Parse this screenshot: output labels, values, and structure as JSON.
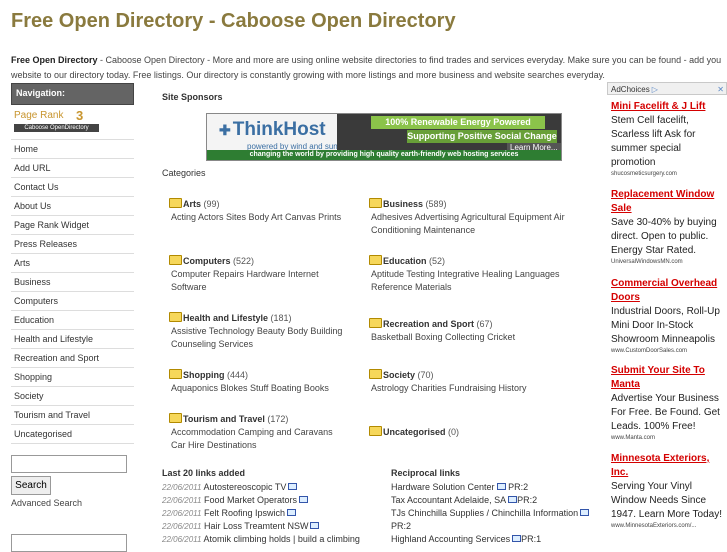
{
  "header": {
    "title": "Free Open Directory - Caboose Open Directory",
    "intro_bold": "Free Open Directory",
    "intro_rest": " - Caboose Open Directory - More and more are using online website directories to find trades and services everyday. Make sure you can be found - add you website to our directory today. Free listings. Our directory is constantly growing with more listings and more business and website searches everyday."
  },
  "sidebar": {
    "nav_title": "Navigation:",
    "page_rank_label": "Page Rank",
    "page_rank_value": "3",
    "page_rank_bar_text": "Caboose OpenDirectory",
    "items": [
      {
        "label": "Home"
      },
      {
        "label": "Add URL"
      },
      {
        "label": "Contact Us"
      },
      {
        "label": "About Us"
      },
      {
        "label": "Page Rank Widget"
      },
      {
        "label": "Press Releases"
      },
      {
        "label": "Arts"
      },
      {
        "label": "Business"
      },
      {
        "label": "Computers"
      },
      {
        "label": "Education"
      },
      {
        "label": "Health and Lifestyle"
      },
      {
        "label": "Recreation and Sport"
      },
      {
        "label": "Shopping"
      },
      {
        "label": "Society"
      },
      {
        "label": "Tourism and Travel"
      },
      {
        "label": "Uncategorised"
      }
    ],
    "search_button": "Search",
    "advanced_search": "Advanced Search"
  },
  "main": {
    "sponsors_title": "Site Sponsors",
    "banner": {
      "logo": "ThinkHost",
      "tagline": "powered by wind and sun",
      "slogan1": "100% Renewable Energy Powered",
      "slogan2": "Supporting Positive Social Change",
      "learn_more": "Learn More...",
      "strip": "changing the world by providing high quality earth-friendly web hosting services"
    },
    "categories_title": "Categories",
    "categories": [
      {
        "name": "Arts",
        "count": " (99)",
        "subs": "Acting Actors Sites Body Art Canvas Prints"
      },
      {
        "name": "Business",
        "count": " (589)",
        "subs": "Adhesives Advertising Agricultural Equipment Air Conditioning Maintenance"
      },
      {
        "name": "Computers",
        "count": " (522)",
        "subs": "Computer Repairs Hardware Internet Software"
      },
      {
        "name": "Education",
        "count": " (52)",
        "subs": "Aptitude Testing Integrative Healing Languages Reference Materials"
      },
      {
        "name": "Health and Lifestyle",
        "count": " (181)",
        "subs": "Assistive Technology Beauty Body Building Counseling Services"
      },
      {
        "name": "Recreation and Sport",
        "count": " (67)",
        "subs": "Basketball Boxing Collecting Cricket"
      },
      {
        "name": "Shopping",
        "count": " (444)",
        "subs": "Aquaponics Blokes Stuff Boating Books"
      },
      {
        "name": "Society",
        "count": " (70)",
        "subs": "Astrology Charities Fundraising History"
      },
      {
        "name": "Tourism and Travel",
        "count": " (172)",
        "subs": "Accommodation Camping and Caravans Car Hire Destinations"
      },
      {
        "name": "Uncategorised",
        "count": " (0)",
        "subs": ""
      }
    ],
    "last_links_title": "Last 20 links added",
    "last_links": [
      {
        "date": "22/06/2011",
        "text": " Autostereoscopic TV"
      },
      {
        "date": "22/06/2011",
        "text": " Food Market Operators"
      },
      {
        "date": "22/06/2011",
        "text": " Felt Roofing Ipswich"
      },
      {
        "date": "22/06/2011",
        "text": " Hair Loss Treamtent NSW"
      },
      {
        "date": "22/06/2011",
        "text": " Atomik climbing holds | build a climbing"
      }
    ],
    "reciprocal_title": "Reciprocal links",
    "reciprocal_links": [
      {
        "text": "Hardware Solution Center",
        "pr": "PR:2"
      },
      {
        "text": "Tax Accountant Adelaide, SA",
        "pr": "PR:2"
      },
      {
        "text": "TJs Chinchilla Supplies / Chinchilla Information",
        "pr": "PR:2"
      },
      {
        "text": "Highland Accounting Services",
        "pr": "PR:1"
      }
    ]
  },
  "ads": {
    "ad_choices": "AdChoices",
    "close": "▷",
    "items": [
      {
        "title": "Mini Facelift & J Lift",
        "body": "Stem Cell facelift, Scarless lift Ask for summer special promotion",
        "url": "shucosmeticsurgery.com"
      },
      {
        "title": "Replacement Window Sale",
        "body": "Save 30-40% by buying direct. Open to public. Energy Star Rated.",
        "url": "UniversalWindowsMN.com"
      },
      {
        "title": "Commercial Overhead Doors",
        "body": "Industrial Doors, Roll-Up Mini Door In-Stock Showroom Minneapolis",
        "url": "www.CustomDoorSales.com"
      },
      {
        "title": "Submit Your Site To Manta",
        "body": "Advertise Your Business For Free. Be Found. Get Leads. 100% Free!",
        "url": "www.Manta.com"
      },
      {
        "title": "Minnesota Exteriors, Inc.",
        "body": "Serving Your Vinyl Window Needs Since 1947. Learn More Today!",
        "url": "www.MinnesotaExteriors.com/..."
      }
    ]
  },
  "colors": {
    "title": "#8a7a3e",
    "ad_title": "#d40000",
    "nav_header": "#646464"
  }
}
